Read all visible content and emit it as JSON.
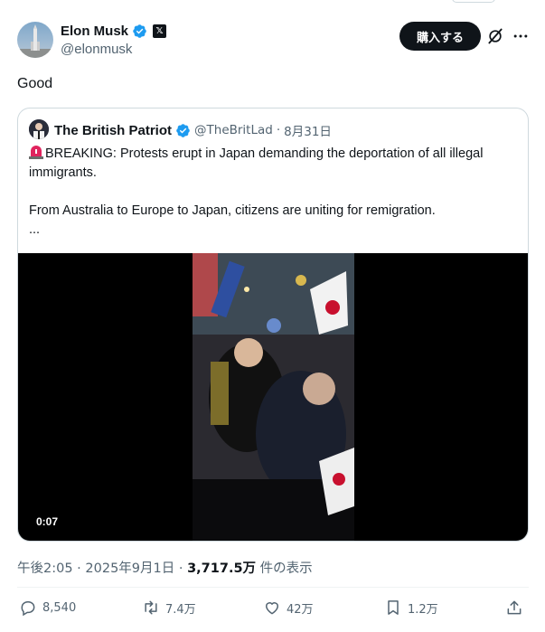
{
  "author": {
    "name": "Elon Musk",
    "handle": "@elonmusk",
    "verified": true,
    "affiliate_badge": "𝕏"
  },
  "header_actions": {
    "buy_label": "購入する"
  },
  "tweet": {
    "text": "Good"
  },
  "quoted": {
    "name": "The British Patriot",
    "handle": "@TheBritLad",
    "date": "8月31日",
    "line1": "BREAKING: Protests erupt in Japan demanding the deportation of all illegal immigrants.",
    "line2": "From Australia to Europe to Japan, citizens are uniting for remigration.",
    "ellipsis": "...",
    "video_time": "0:07"
  },
  "meta": {
    "time": "午後2:05",
    "date": "2025年9月1日",
    "views": "3,717.5万",
    "views_label": "件の表示",
    "separator": "·"
  },
  "actions": {
    "replies": "8,540",
    "reposts": "7.4万",
    "likes": "42万",
    "bookmarks": "1.2万"
  },
  "colors": {
    "verified": "#1d9bf0",
    "text_secondary": "#536471",
    "button_bg": "#0f1419"
  }
}
